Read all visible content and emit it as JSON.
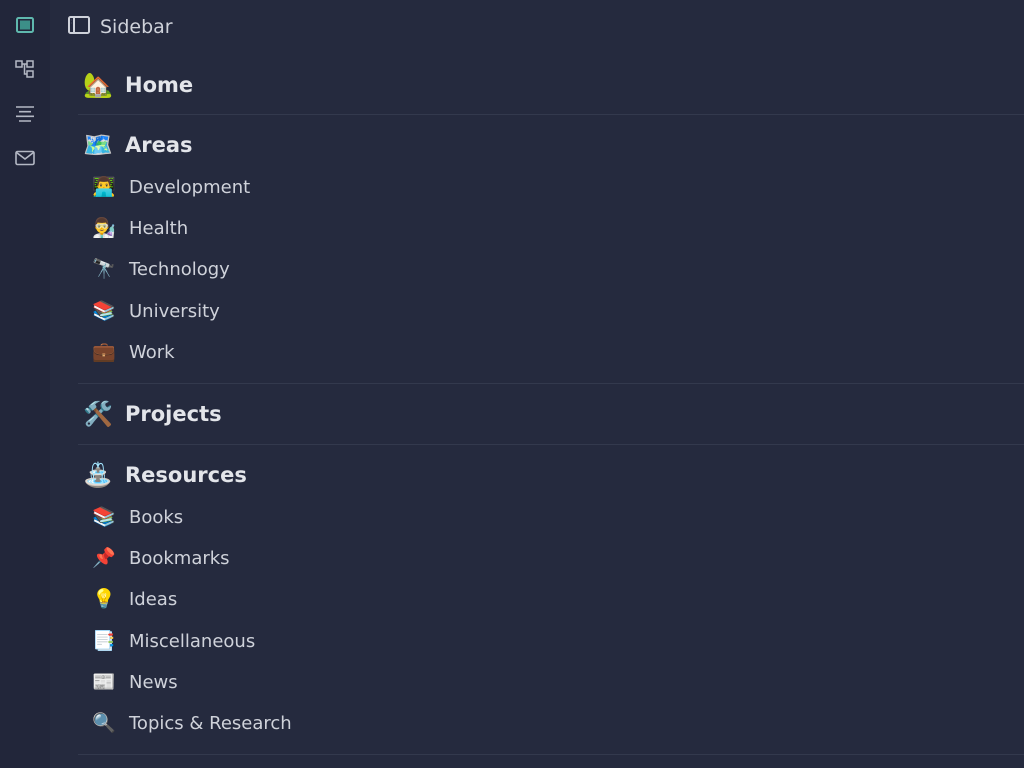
{
  "rail": {
    "icons": [
      "sidebar-toggle-icon",
      "graph-icon",
      "outline-icon",
      "mail-icon"
    ],
    "accent": "#5fb8ae"
  },
  "header": {
    "title": "Sidebar"
  },
  "sections": [
    {
      "emoji": "🏡",
      "title": "Home",
      "items": []
    },
    {
      "emoji": "🗺️",
      "title": "Areas",
      "items": [
        {
          "emoji": "👨‍💻",
          "label": "Development"
        },
        {
          "emoji": "👨‍🔬",
          "label": "Health"
        },
        {
          "emoji": "🔭",
          "label": "Technology"
        },
        {
          "emoji": "📚",
          "label": "University"
        },
        {
          "emoji": "💼",
          "label": "Work"
        }
      ]
    },
    {
      "emoji": "🛠️",
      "title": "Projects",
      "items": []
    },
    {
      "emoji": "⛲",
      "title": "Resources",
      "items": [
        {
          "emoji": "📚",
          "label": "Books"
        },
        {
          "emoji": "📌",
          "label": "Bookmarks"
        },
        {
          "emoji": "💡",
          "label": "Ideas"
        },
        {
          "emoji": "📑",
          "label": "Miscellaneous"
        },
        {
          "emoji": "📰",
          "label": "News"
        },
        {
          "emoji": "🔍",
          "label": "Topics & Research"
        }
      ]
    }
  ]
}
